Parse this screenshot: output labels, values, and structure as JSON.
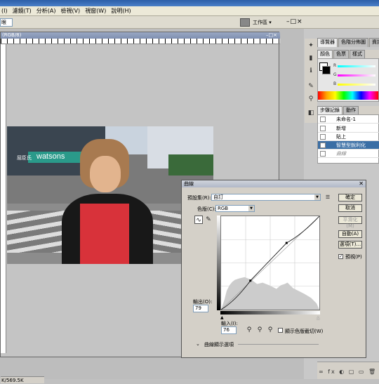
{
  "menu": [
    "(I)",
    "濾鏡(T)",
    "分析(A)",
    "檢視(V)",
    "視窗(W)",
    "說明(H)"
  ],
  "options": {
    "field_value": "眼",
    "workspace_label": "工作區 ▾",
    "ctrl_icons": "–□×"
  },
  "document": {
    "title": "(RGB/8)",
    "status": "K/569.5K",
    "buttons": "–□×"
  },
  "panels": {
    "nav_tabs": [
      "導覽器",
      "色階分佈圖",
      "資訊"
    ],
    "color_tabs": [
      "顏色",
      "色票",
      "樣式"
    ],
    "color_labels": [
      "R",
      "G",
      "B"
    ],
    "history_tabs": [
      "步驟記錄",
      "動作"
    ],
    "history_items": [
      {
        "label": "未命名-1",
        "selected": false
      },
      {
        "label": "新增",
        "selected": false
      },
      {
        "label": "貼上",
        "selected": false
      },
      {
        "label": "智慧型銳利化",
        "selected": true
      },
      {
        "label": "曲線",
        "selected": false
      }
    ]
  },
  "curves": {
    "title": "曲線",
    "preset_label": "預設集(R):",
    "preset_value": "自訂",
    "channel_label": "色版(C):",
    "channel_value": "RGB",
    "output_label": "輸出(O):",
    "output_value": "79",
    "input_label": "輸入(I):",
    "input_value": "76",
    "clipping_label": "顯示色版截切(W)",
    "display_options": "曲線顯示選項",
    "buttons": {
      "ok": "確定",
      "cancel": "取消",
      "smooth": "平滑化(M)",
      "auto": "自動(A)",
      "options": "選項(T)...",
      "preview": "預視(P)"
    },
    "preview_checked": true,
    "curve_points": [
      [
        0,
        0
      ],
      [
        76,
        79
      ],
      [
        170,
        182
      ],
      [
        255,
        255
      ]
    ]
  },
  "photo": {
    "sign": "watsons",
    "sign2": "屈臣氏"
  },
  "colors": {
    "accent": "#3a6ea5",
    "titlebar": "#2c5fa8"
  }
}
